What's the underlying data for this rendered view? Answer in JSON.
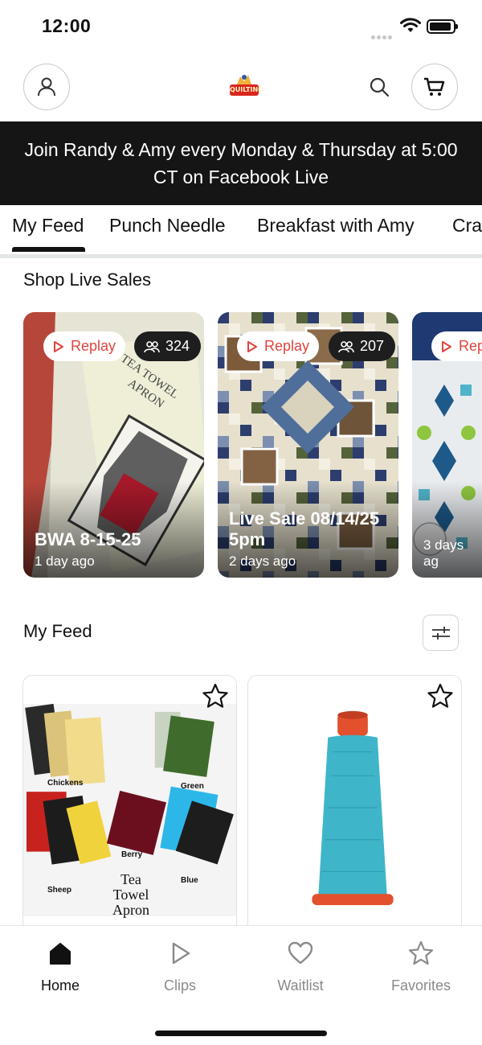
{
  "status_bar": {
    "time": "12:00"
  },
  "header": {
    "logo_text": "QUILTING",
    "icons": [
      "profile-icon",
      "logo",
      "search-icon",
      "cart-icon"
    ]
  },
  "banner": {
    "text": "Join Randy & Amy every Monday & Thursday at 5:00 CT on Facebook Live"
  },
  "tabs": [
    {
      "label": "My Feed",
      "active": true
    },
    {
      "label": "Punch Needle",
      "active": false
    },
    {
      "label": "Breakfast with Amy",
      "active": false
    },
    {
      "label": "Cra",
      "active": false
    }
  ],
  "live_sales": {
    "title": "Shop Live Sales",
    "cards": [
      {
        "replay": "Replay",
        "views": "324",
        "title": "BWA 8-15-25",
        "time": "1 day ago"
      },
      {
        "replay": "Replay",
        "views": "207",
        "title": "Live Sale 08/14/25 5pm",
        "time": "2 days ago"
      },
      {
        "replay": "Rep",
        "views": "",
        "title": "",
        "time": "3 days ag"
      }
    ]
  },
  "feed": {
    "title": "My Feed",
    "products": [
      {
        "image": "tea-towel-fabric-kit",
        "labels": [
          "Chickens",
          "Green",
          "Berry",
          "Sheep",
          "Blue",
          "Tea",
          "Towel",
          "Apron"
        ]
      },
      {
        "image": "blue-thread-spool",
        "labels": []
      }
    ]
  },
  "bottom_nav": [
    {
      "label": "Home",
      "icon": "home-icon",
      "active": true
    },
    {
      "label": "Clips",
      "icon": "play-icon",
      "active": false
    },
    {
      "label": "Waitlist",
      "icon": "heart-icon",
      "active": false
    },
    {
      "label": "Favorites",
      "icon": "star-icon",
      "active": false
    }
  ],
  "colors": {
    "accent": "#e0433e",
    "banner_bg": "#151515",
    "thread": "#3fb5c9",
    "thread_cap": "#e2502d"
  }
}
